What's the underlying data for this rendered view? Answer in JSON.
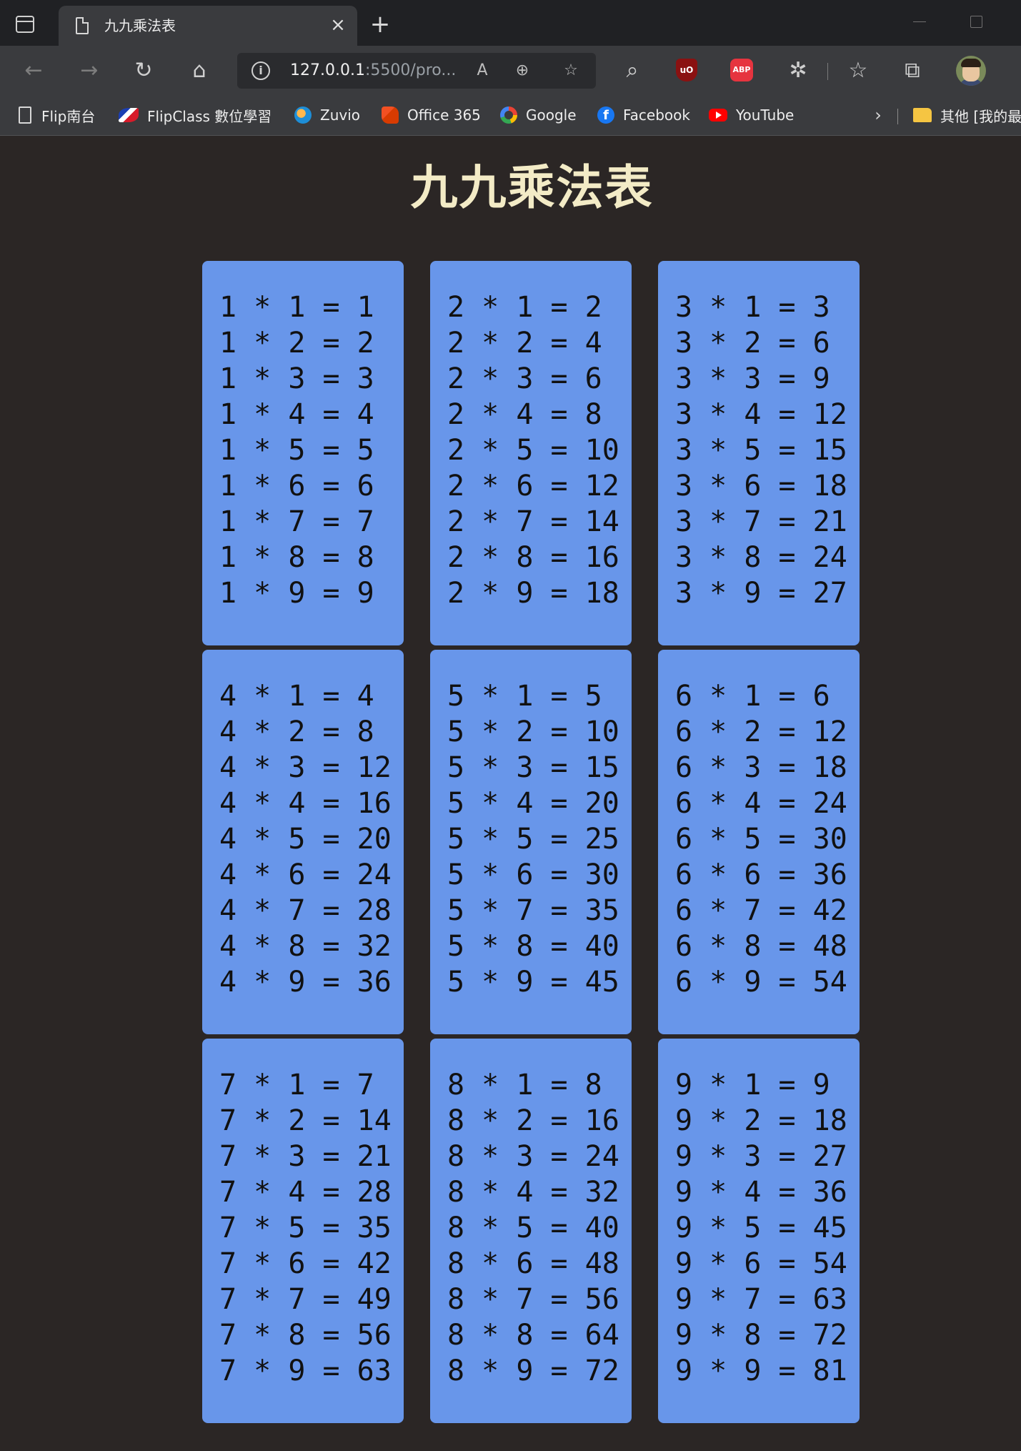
{
  "browser": {
    "tab_title": "九九乘法表",
    "tab_close": "×",
    "new_tab": "+",
    "address": {
      "host": "127.0.0.1",
      "rest": ":5500/pro..."
    },
    "nav": {
      "back": "←",
      "forward": "→",
      "reload": "↻",
      "home": "⌂"
    },
    "address_icons": {
      "info": "i",
      "read_aloud": "A",
      "zoom": "⊕",
      "favorite_add": "☆"
    },
    "ext": {
      "search": "⌕",
      "ublock": "uO",
      "abp": "ABP",
      "extensions": "✲",
      "favorites": "☆",
      "collections": "⧉"
    },
    "bookmarks": [
      {
        "label": "Flip南台",
        "icon": "page-icon"
      },
      {
        "label": "FlipClass 數位學習",
        "icon": "flipclass-icon"
      },
      {
        "label": "Zuvio",
        "icon": "zuvio-icon"
      },
      {
        "label": "Office 365",
        "icon": "office-icon"
      },
      {
        "label": "Google",
        "icon": "google-icon"
      },
      {
        "label": "Facebook",
        "icon": "facebook-icon"
      },
      {
        "label": "YouTube",
        "icon": "youtube-icon"
      }
    ],
    "bookmarks_chevron": "›",
    "other_folder": "其他 [我的最"
  },
  "page": {
    "title": "九九乘法表"
  },
  "tables": [
    {
      "n": 1,
      "rows": [
        "1 * 1 = 1",
        "1 * 2 = 2",
        "1 * 3 = 3",
        "1 * 4 = 4",
        "1 * 5 = 5",
        "1 * 6 = 6",
        "1 * 7 = 7",
        "1 * 8 = 8",
        "1 * 9 = 9"
      ]
    },
    {
      "n": 2,
      "rows": [
        "2 * 1 = 2",
        "2 * 2 = 4",
        "2 * 3 = 6",
        "2 * 4 = 8",
        "2 * 5 = 10",
        "2 * 6 = 12",
        "2 * 7 = 14",
        "2 * 8 = 16",
        "2 * 9 = 18"
      ]
    },
    {
      "n": 3,
      "rows": [
        "3 * 1 = 3",
        "3 * 2 = 6",
        "3 * 3 = 9",
        "3 * 4 = 12",
        "3 * 5 = 15",
        "3 * 6 = 18",
        "3 * 7 = 21",
        "3 * 8 = 24",
        "3 * 9 = 27"
      ]
    },
    {
      "n": 4,
      "rows": [
        "4 * 1 = 4",
        "4 * 2 = 8",
        "4 * 3 = 12",
        "4 * 4 = 16",
        "4 * 5 = 20",
        "4 * 6 = 24",
        "4 * 7 = 28",
        "4 * 8 = 32",
        "4 * 9 = 36"
      ]
    },
    {
      "n": 5,
      "rows": [
        "5 * 1 = 5",
        "5 * 2 = 10",
        "5 * 3 = 15",
        "5 * 4 = 20",
        "5 * 5 = 25",
        "5 * 6 = 30",
        "5 * 7 = 35",
        "5 * 8 = 40",
        "5 * 9 = 45"
      ]
    },
    {
      "n": 6,
      "rows": [
        "6 * 1 = 6",
        "6 * 2 = 12",
        "6 * 3 = 18",
        "6 * 4 = 24",
        "6 * 5 = 30",
        "6 * 6 = 36",
        "6 * 7 = 42",
        "6 * 8 = 48",
        "6 * 9 = 54"
      ]
    },
    {
      "n": 7,
      "rows": [
        "7 * 1 = 7",
        "7 * 2 = 14",
        "7 * 3 = 21",
        "7 * 4 = 28",
        "7 * 5 = 35",
        "7 * 6 = 42",
        "7 * 7 = 49",
        "7 * 8 = 56",
        "7 * 9 = 63"
      ]
    },
    {
      "n": 8,
      "rows": [
        "8 * 1 = 8",
        "8 * 2 = 16",
        "8 * 3 = 24",
        "8 * 4 = 32",
        "8 * 5 = 40",
        "8 * 6 = 48",
        "8 * 7 = 56",
        "8 * 8 = 64",
        "8 * 9 = 72"
      ]
    },
    {
      "n": 9,
      "rows": [
        "9 * 1 = 9",
        "9 * 2 = 18",
        "9 * 3 = 27",
        "9 * 4 = 36",
        "9 * 5 = 45",
        "9 * 6 = 54",
        "9 * 7 = 63",
        "9 * 8 = 72",
        "9 * 9 = 81"
      ]
    }
  ],
  "colors": {
    "page_background": "#2b2625",
    "title": "#f3ebc6",
    "card": "#6896ea",
    "card_text": "#111111"
  }
}
